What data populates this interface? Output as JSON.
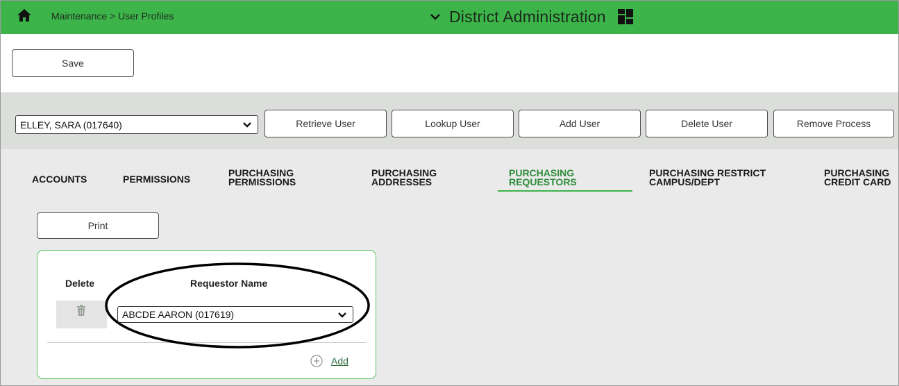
{
  "header": {
    "breadcrumb": "Maintenance > User Profiles",
    "app_title": "District Administration",
    "bar_color": "#3cb44a"
  },
  "toolbar": {
    "save_label": "Save"
  },
  "user_bar": {
    "selected_user": "ELLEY, SARA (017640)",
    "buttons": {
      "retrieve": "Retrieve User",
      "lookup": "Lookup User",
      "add": "Add User",
      "delete": "Delete User",
      "remove_process": "Remove Process"
    }
  },
  "tabs": [
    {
      "label": "ACCOUNTS"
    },
    {
      "label": "PERMISSIONS"
    },
    {
      "label": "PURCHASING\nPERMISSIONS"
    },
    {
      "label": "PURCHASING\nADDRESSES"
    },
    {
      "label": "PURCHASING\nREQUESTORS",
      "active": true
    },
    {
      "label": "PURCHASING RESTRICT\nCAMPUS/DEPT"
    },
    {
      "label": "PURCHASING\nCREDIT CARD"
    }
  ],
  "main": {
    "print_label": "Print",
    "table": {
      "col_delete": "Delete",
      "col_requestor": "Requestor Name",
      "rows": [
        {
          "requestor": "ABCDE AARON (017619)"
        }
      ]
    },
    "add_label": "Add"
  },
  "icons": {
    "home": "home-icon",
    "title_chevron": "chevron-down-icon",
    "apps": "grid-icon",
    "trash": "trash-icon",
    "add": "plus-circle-icon"
  }
}
